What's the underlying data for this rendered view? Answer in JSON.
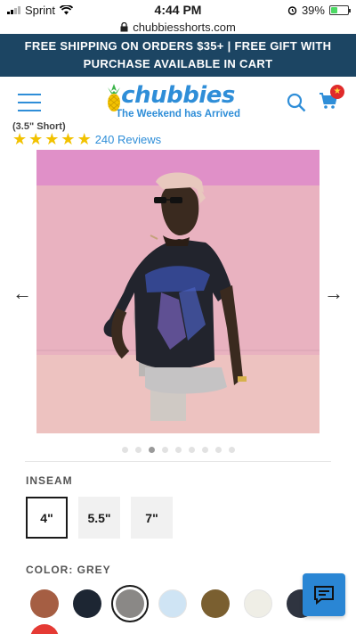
{
  "status_bar": {
    "carrier": "Sprint",
    "time": "4:44 PM",
    "battery": "39%"
  },
  "browser": {
    "url": "chubbiesshorts.com"
  },
  "promo": {
    "line1": "FREE SHIPPING ON ORDERS $35+ | FREE GIFT WITH",
    "line2": "PURCHASE AVAILABLE IN CART"
  },
  "header": {
    "logo": "chubbies",
    "tagline": "The Weekend has Arrived",
    "cart_badge": "★"
  },
  "product": {
    "cut_title_fragment": "(3.5\" Short)",
    "rating": 5,
    "reviews_label": "240 Reviews"
  },
  "gallery": {
    "dot_count": 9,
    "active_dot": 2,
    "prev_arrow": "←",
    "next_arrow": "→"
  },
  "inseam": {
    "label": "INSEAM",
    "options": [
      "4\"",
      "5.5\"",
      "7\""
    ],
    "selected": "4\""
  },
  "color": {
    "label": "COLOR: GREY",
    "swatches": [
      "#a55e43",
      "#1d2633",
      "#8a8886",
      "#cfe4f4",
      "#7a5f30",
      "#efeee6",
      "#2f3440"
    ],
    "selected_index": 2,
    "next_row_first": "#e53a34"
  }
}
